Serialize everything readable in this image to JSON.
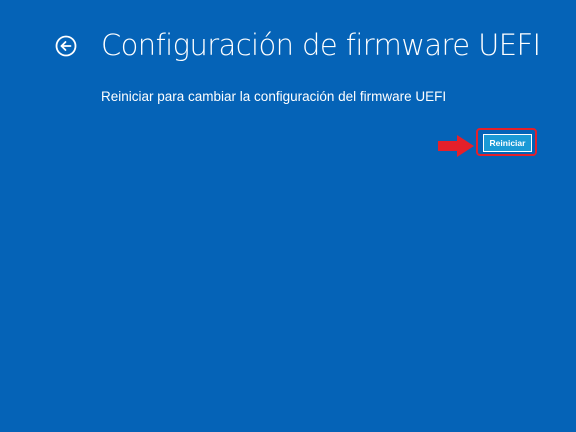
{
  "header": {
    "title": "Configuración de firmware UEFI",
    "back_icon": "back-arrow-circle-icon"
  },
  "main": {
    "description": "Reiniciar para cambiar la configuración del firmware UEFI",
    "restart_label": "Reiniciar"
  },
  "annotation": {
    "pointer_icon": "red-arrow-icon",
    "highlight_color": "#e5202a"
  },
  "colors": {
    "background": "#0563b7",
    "button": "#1a9ad6",
    "text": "#ffffff"
  }
}
